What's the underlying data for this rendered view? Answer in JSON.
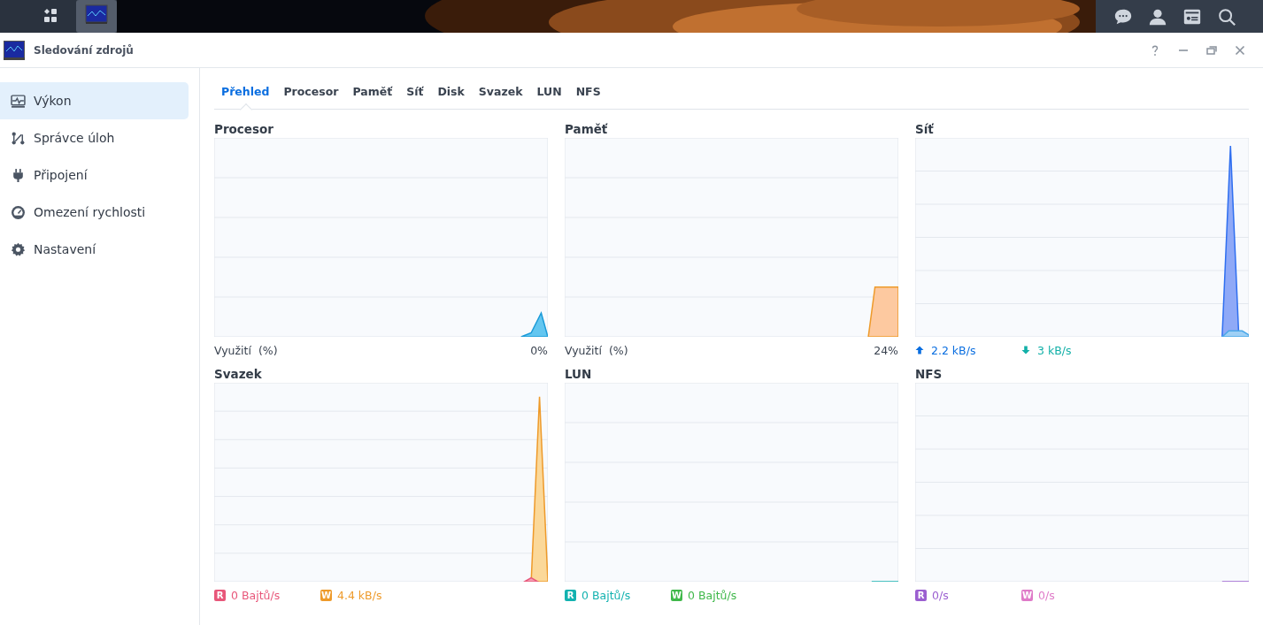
{
  "window": {
    "title": "Sledování zdrojů"
  },
  "sidebar": {
    "items": [
      {
        "label": "Výkon",
        "selected": true
      },
      {
        "label": "Správce úloh",
        "selected": false
      },
      {
        "label": "Připojení",
        "selected": false
      },
      {
        "label": "Omezení rychlosti",
        "selected": false
      },
      {
        "label": "Nastavení",
        "selected": false
      }
    ]
  },
  "tabs": [
    {
      "label": "Přehled",
      "selected": true
    },
    {
      "label": "Procesor",
      "selected": false
    },
    {
      "label": "Paměť",
      "selected": false
    },
    {
      "label": "Síť",
      "selected": false
    },
    {
      "label": "Disk",
      "selected": false
    },
    {
      "label": "Svazek",
      "selected": false
    },
    {
      "label": "LUN",
      "selected": false
    },
    {
      "label": "NFS",
      "selected": false
    }
  ],
  "panels": [
    {
      "title": "Procesor",
      "footer": {
        "kind": "usage",
        "label": "Využití  (%)",
        "value": "0%"
      }
    },
    {
      "title": "Paměť",
      "footer": {
        "kind": "usage",
        "label": "Využití  (%)",
        "value": "24%"
      }
    },
    {
      "title": "Síť",
      "footer": {
        "kind": "legend",
        "items": [
          {
            "kind": "up",
            "value": "2.2 kB/s",
            "color": "#0a6ee0"
          },
          {
            "kind": "down",
            "value": "3 kB/s",
            "color": "#12b0a8"
          }
        ]
      }
    },
    {
      "title": "Svazek",
      "footer": {
        "kind": "legend",
        "items": [
          {
            "kind": "badge",
            "badge": "R",
            "value": "0 Bajtů/s",
            "color": "#e8577a"
          },
          {
            "kind": "badge",
            "badge": "W",
            "value": "4.4 kB/s",
            "color": "#ee9a2a"
          }
        ]
      }
    },
    {
      "title": "LUN",
      "footer": {
        "kind": "legend",
        "items": [
          {
            "kind": "badge",
            "badge": "R",
            "value": "0 Bajtů/s",
            "color": "#13b2b0"
          },
          {
            "kind": "badge",
            "badge": "W",
            "value": "0 Bajtů/s",
            "color": "#3fb84a"
          }
        ]
      }
    },
    {
      "title": "NFS",
      "footer": {
        "kind": "legend",
        "items": [
          {
            "kind": "badge",
            "badge": "R",
            "value": "0/s",
            "color": "#9b5fd0"
          },
          {
            "kind": "badge",
            "badge": "W",
            "value": "0/s",
            "color": "#df7ac8"
          }
        ]
      }
    }
  ]
}
